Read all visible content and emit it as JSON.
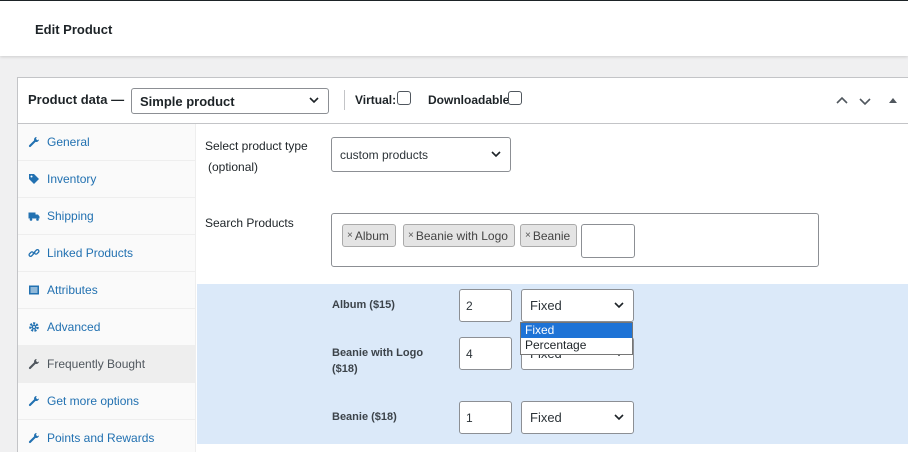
{
  "page": {
    "title": "Edit Product"
  },
  "product_data": {
    "label": "Product data —",
    "type_select": "Simple product",
    "virtual_label": "Virtual:",
    "downloadable_label": "Downloadable:"
  },
  "tabs": [
    {
      "label": "General",
      "icon": "wrench-icon"
    },
    {
      "label": "Inventory",
      "icon": "tag-icon"
    },
    {
      "label": "Shipping",
      "icon": "truck-icon"
    },
    {
      "label": "Linked Products",
      "icon": "link-icon"
    },
    {
      "label": "Attributes",
      "icon": "list-icon"
    },
    {
      "label": "Advanced",
      "icon": "gear-icon"
    },
    {
      "label": "Frequently Bought",
      "icon": "wrench-icon"
    },
    {
      "label": "Get more options",
      "icon": "wrench-icon"
    },
    {
      "label": "Points and Rewards",
      "icon": "wrench-icon"
    }
  ],
  "form": {
    "select_type_label_line1": "Select product type",
    "select_type_label_line2": "(optional)",
    "select_type_value": "custom products",
    "search_label": "Search Products",
    "tags": [
      "Album",
      "Beanie with Logo",
      "Beanie"
    ]
  },
  "products": [
    {
      "name_line1": "Album ($15)",
      "name_line2": "",
      "qty": "2",
      "discount": "Fixed"
    },
    {
      "name_line1": "Beanie with Logo",
      "name_line2": "($18)",
      "qty": "4",
      "discount": "Fixed"
    },
    {
      "name_line1": "Beanie ($18)",
      "name_line2": "",
      "qty": "1",
      "discount": "Fixed"
    }
  ],
  "dropdown_open": {
    "options": [
      "Fixed",
      "Percentage"
    ],
    "highlighted": "Fixed"
  },
  "colors": {
    "accent": "#2271b1",
    "row_bg": "#dbe9f9",
    "highlight": "#1e73d6"
  }
}
